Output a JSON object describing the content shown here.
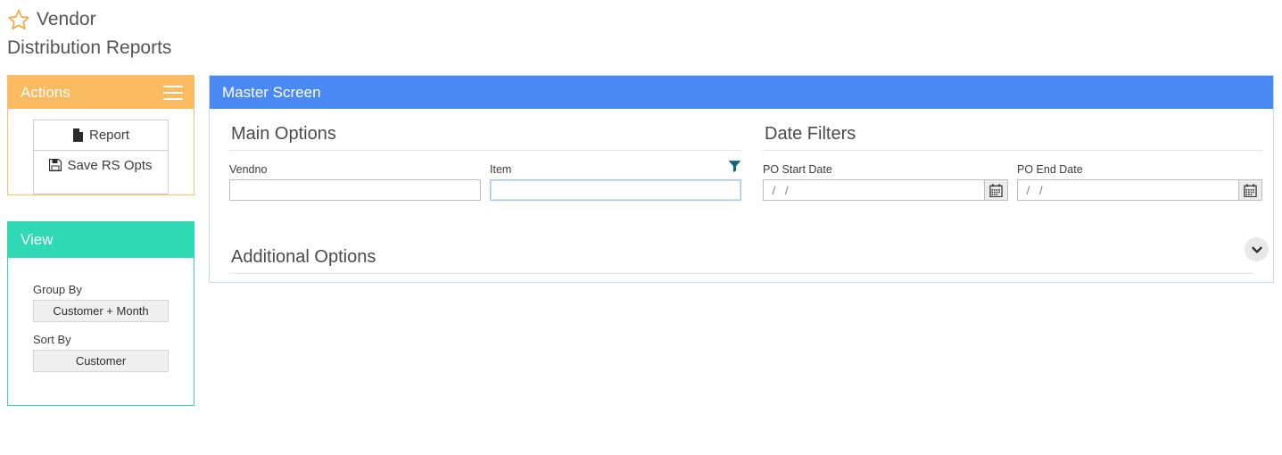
{
  "page": {
    "star_icon": "star-outline-icon",
    "title_line1": "Vendor",
    "title_line2": "Distribution Reports"
  },
  "actions_panel": {
    "header_title": "Actions",
    "menu_icon": "hamburger-menu-icon",
    "accent_color": "#fbba5f",
    "buttons": [
      {
        "label": "Report",
        "icon": "file-document-icon"
      },
      {
        "label": "Save RS Opts",
        "icon": "floppy-disk-save-icon"
      }
    ]
  },
  "view_panel": {
    "header_title": "View",
    "accent_color": "#2fd9b4",
    "fields": [
      {
        "label": "Group By",
        "value": "Customer + Month"
      },
      {
        "label": "Sort By",
        "value": "Customer"
      }
    ]
  },
  "master_screen": {
    "header_title": "Master Screen",
    "accent_color": "#4a89f3",
    "main_options": {
      "title": "Main Options",
      "filter_icon": "funnel-filter-icon",
      "fields": [
        {
          "name": "vendno",
          "label": "Vendno",
          "value": "",
          "placeholder": "",
          "focused": false
        },
        {
          "name": "item",
          "label": "Item",
          "value": "",
          "placeholder": "",
          "focused": true
        }
      ]
    },
    "date_filters": {
      "title": "Date Filters",
      "calendar_icon": "calendar-icon",
      "fields": [
        {
          "name": "po-start-date",
          "label": "PO Start Date",
          "value": "",
          "placeholder": " /   /  "
        },
        {
          "name": "po-end-date",
          "label": "PO End Date",
          "value": "",
          "placeholder": " /   /  "
        }
      ]
    },
    "additional_options": {
      "title": "Additional Options",
      "expand_icon": "chevron-down-icon"
    }
  }
}
